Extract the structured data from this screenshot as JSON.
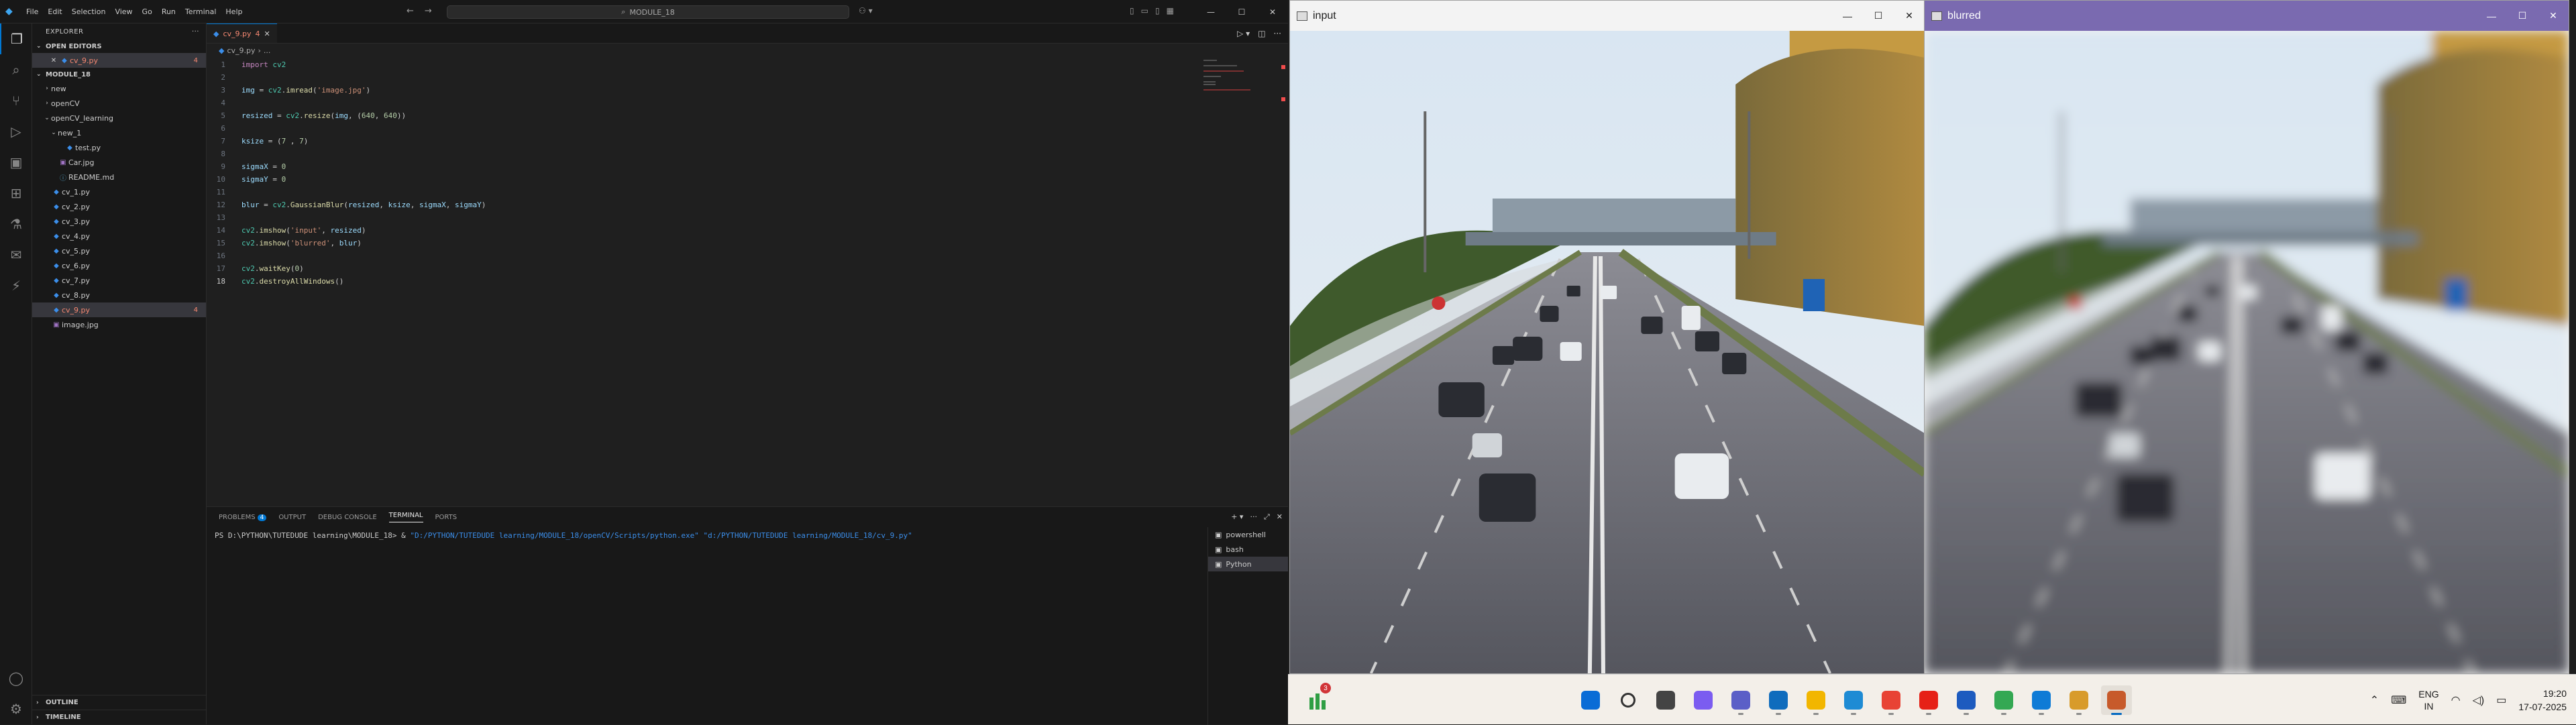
{
  "vscode": {
    "menu": [
      "File",
      "Edit",
      "Selection",
      "View",
      "Go",
      "Run",
      "Terminal",
      "Help"
    ],
    "search_text": "MODULE_18",
    "explorer_title": "EXPLORER",
    "open_editors_label": "OPEN EDITORS",
    "open_editor_file": "cv_9.py",
    "open_editor_badge": "4",
    "workspace_label": "MODULE_18",
    "tree": [
      {
        "label": "new",
        "kind": "folder",
        "indent": 1,
        "chev": "›"
      },
      {
        "label": "openCV",
        "kind": "folder",
        "indent": 1,
        "chev": "›"
      },
      {
        "label": "openCV_learning",
        "kind": "folder",
        "indent": 1,
        "chev": "⌄"
      },
      {
        "label": "new_1",
        "kind": "folder",
        "indent": 2,
        "chev": "⌄"
      },
      {
        "label": "test.py",
        "kind": "py",
        "indent": 3
      },
      {
        "label": "Car.jpg",
        "kind": "img",
        "indent": 2
      },
      {
        "label": "README.md",
        "kind": "md",
        "indent": 2
      },
      {
        "label": "cv_1.py",
        "kind": "py",
        "indent": 1
      },
      {
        "label": "cv_2.py",
        "kind": "py",
        "indent": 1
      },
      {
        "label": "cv_3.py",
        "kind": "py",
        "indent": 1
      },
      {
        "label": "cv_4.py",
        "kind": "py",
        "indent": 1
      },
      {
        "label": "cv_5.py",
        "kind": "py",
        "indent": 1
      },
      {
        "label": "cv_6.py",
        "kind": "py",
        "indent": 1
      },
      {
        "label": "cv_7.py",
        "kind": "py",
        "indent": 1
      },
      {
        "label": "cv_8.py",
        "kind": "py",
        "indent": 1
      },
      {
        "label": "cv_9.py",
        "kind": "py",
        "indent": 1,
        "badge": "4",
        "selected": true
      },
      {
        "label": "image.jpg",
        "kind": "img",
        "indent": 1
      }
    ],
    "outline_label": "OUTLINE",
    "timeline_label": "TIMELINE",
    "tab_label": "cv_9.py",
    "tab_badge": "4",
    "breadcrumb": [
      "cv_9.py",
      "..."
    ],
    "code_lines": [
      "import cv2",
      "",
      "img = cv2.imread('image.jpg')",
      "",
      "resized = cv2.resize(img, (640, 640))",
      "",
      "ksize = (7 , 7)",
      "",
      "sigmaX = 0",
      "sigmaY = 0",
      "",
      "blur = cv2.GaussianBlur(resized, ksize, sigmaX, sigmaY)",
      "",
      "cv2.imshow('input', resized)",
      "cv2.imshow('blurred', blur)",
      "",
      "cv2.waitKey(0)",
      "cv2.destroyAllWindows()"
    ],
    "current_line": 18,
    "panel_tabs": [
      "PROBLEMS",
      "OUTPUT",
      "DEBUG CONSOLE",
      "TERMINAL",
      "PORTS"
    ],
    "problems_count": "4",
    "active_panel_tab": "TERMINAL",
    "terminal_prompt": "PS D:\\PYTHON\\TUTEDUDE learning\\MODULE_18> & ",
    "terminal_cmd": "\"D:/PYTHON/TUTEDUDE learning/MODULE_18/openCV/Scripts/python.exe\" \"d:/PYTHON/TUTEDUDE learning/MODULE_18/cv_9.py\"",
    "terminals": [
      "powershell",
      "bash",
      "Python"
    ],
    "active_terminal": "Python"
  },
  "windows": {
    "input_title": "input",
    "blurred_title": "blurred"
  },
  "taskbar": {
    "widget_badge": "3",
    "lang_line1": "ENG",
    "lang_line2": "IN",
    "time": "19:20",
    "date": "17-07-2025",
    "apps": [
      {
        "name": "start",
        "color": "#0a6cd6"
      },
      {
        "name": "search",
        "color": "#333333"
      },
      {
        "name": "task-view",
        "color": "#444444"
      },
      {
        "name": "copilot",
        "color": "#7b5cf0"
      },
      {
        "name": "teams",
        "color": "#5b5fc7"
      },
      {
        "name": "outlook",
        "color": "#0f6cbd"
      },
      {
        "name": "file-explorer",
        "color": "#f2b600"
      },
      {
        "name": "edge",
        "color": "#1e8bd4"
      },
      {
        "name": "chrome",
        "color": "#e84335"
      },
      {
        "name": "youtube",
        "color": "#e62117"
      },
      {
        "name": "word",
        "color": "#1d5bbf"
      },
      {
        "name": "chrome-profile",
        "color": "#34a853"
      },
      {
        "name": "vscode",
        "color": "#0f7bd6"
      },
      {
        "name": "file-manager",
        "color": "#d89b2b"
      },
      {
        "name": "python-window",
        "color": "#c75a2b"
      }
    ]
  }
}
